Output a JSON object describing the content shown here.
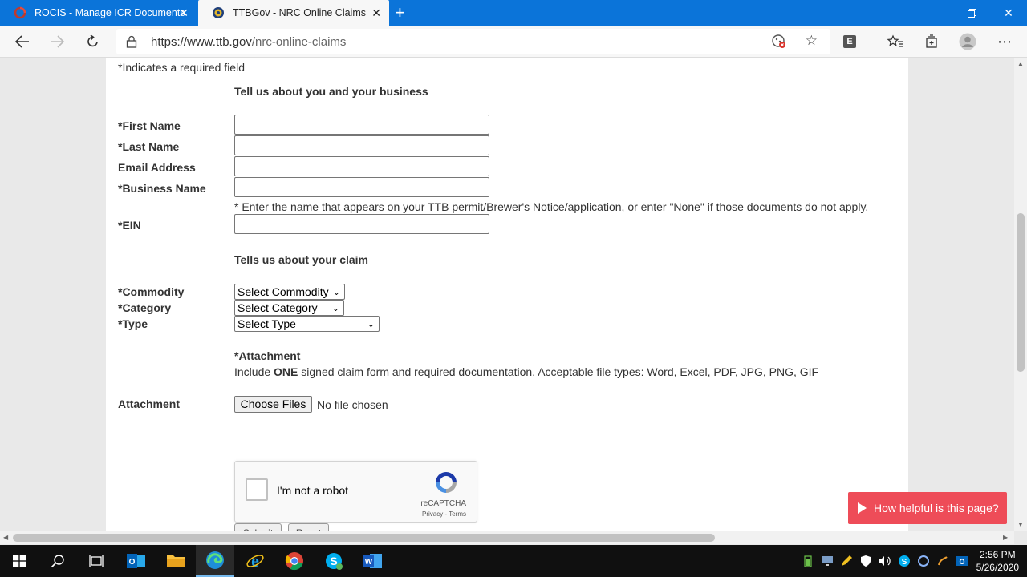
{
  "browser": {
    "tabs": [
      {
        "title": "ROCIS - Manage ICR Documents",
        "icon": "rocis-favicon"
      },
      {
        "title": "TTBGov - NRC Online Claims",
        "icon": "ttb-seal-favicon",
        "active": true
      }
    ],
    "url": {
      "prefix": "https://www.ttb.gov",
      "path": "/nrc-online-claims"
    },
    "extension_badge": "E"
  },
  "form": {
    "required_note": "*Indicates a required field",
    "section_you": "Tell us about you and your business",
    "fields": {
      "first_name": "*First Name",
      "last_name": "*Last Name",
      "email": "Email Address",
      "business_name": "*Business Name",
      "business_hint": "* Enter the name that appears on your TTB permit/Brewer's Notice/application, or enter \"None\" if those documents do not apply.",
      "ein": "*EIN"
    },
    "section_claim": "Tells us about your claim",
    "selects": {
      "commodity_label": "*Commodity",
      "commodity_value": "Select Commodity",
      "category_label": "*Category",
      "category_value": "Select Category",
      "type_label": "*Type",
      "type_value": "Select Type"
    },
    "attachment": {
      "heading": "*Attachment",
      "note_before": "Include ",
      "note_strong": "ONE",
      "note_after": " signed claim form and required documentation.  Acceptable file types: Word, Excel, PDF, JPG, PNG, GIF",
      "label": "Attachment",
      "button": "Choose Files",
      "status": "No file chosen"
    },
    "captcha": {
      "label": "I'm not a robot",
      "brand": "reCAPTCHA",
      "terms": "Privacy - Terms"
    },
    "buttons": {
      "submit": "Submit",
      "reset": "Reset"
    }
  },
  "feedback_button": "How helpful is this page?",
  "taskbar": {
    "time": "2:56 PM",
    "date": "5/26/2020"
  }
}
